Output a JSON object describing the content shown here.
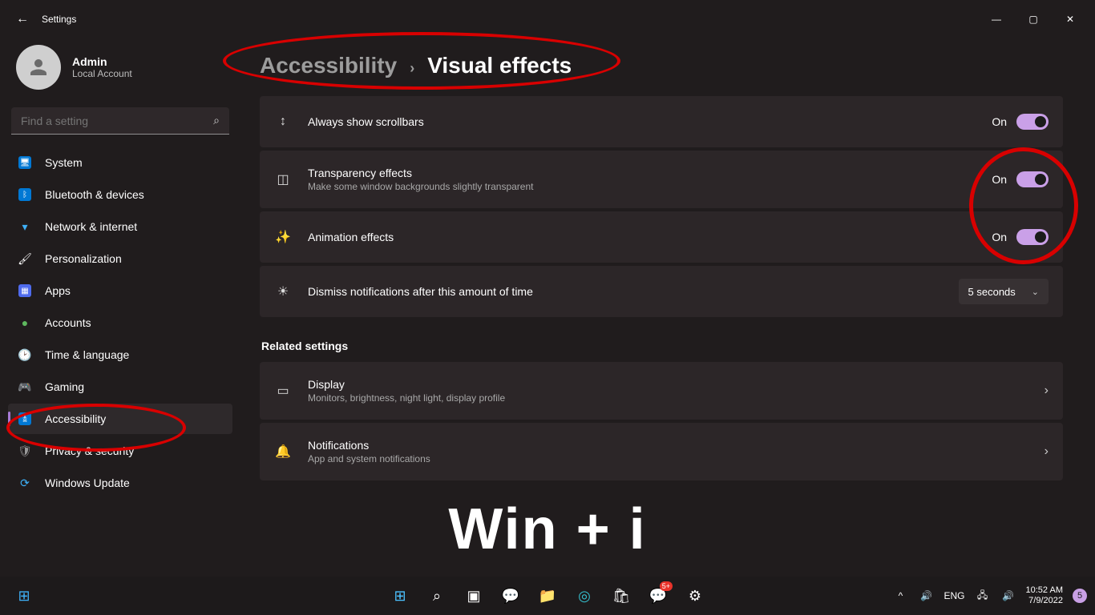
{
  "window": {
    "title": "Settings"
  },
  "account": {
    "name": "Admin",
    "sub": "Local Account"
  },
  "search": {
    "placeholder": "Find a setting"
  },
  "sidebar": {
    "items": [
      {
        "label": "System"
      },
      {
        "label": "Bluetooth & devices"
      },
      {
        "label": "Network & internet"
      },
      {
        "label": "Personalization"
      },
      {
        "label": "Apps"
      },
      {
        "label": "Accounts"
      },
      {
        "label": "Time & language"
      },
      {
        "label": "Gaming"
      },
      {
        "label": "Accessibility"
      },
      {
        "label": "Privacy & security"
      },
      {
        "label": "Windows Update"
      }
    ]
  },
  "breadcrumb": {
    "parent": "Accessibility",
    "page": "Visual effects"
  },
  "settings": {
    "scrollbars": {
      "title": "Always show scrollbars",
      "state": "On"
    },
    "transparency": {
      "title": "Transparency effects",
      "sub": "Make some window backgrounds slightly transparent",
      "state": "On"
    },
    "animation": {
      "title": "Animation effects",
      "state": "On"
    },
    "dismiss": {
      "title": "Dismiss notifications after this amount of time",
      "value": "5 seconds"
    }
  },
  "related": {
    "heading": "Related settings",
    "display": {
      "title": "Display",
      "sub": "Monitors, brightness, night light, display profile"
    },
    "notifications": {
      "title": "Notifications",
      "sub": "App and system notifications"
    }
  },
  "overlay": {
    "bigtext": "Win + i"
  },
  "taskbar": {
    "lang": "ENG",
    "time": "10:52 AM",
    "date": "7/9/2022",
    "badge": "5"
  }
}
